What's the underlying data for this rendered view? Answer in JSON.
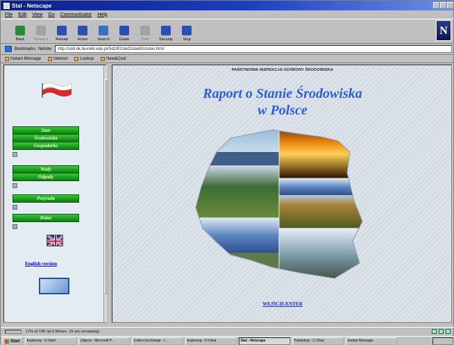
{
  "window": {
    "title": "Stal - Netscape"
  },
  "menu": [
    "File",
    "Edit",
    "View",
    "Go",
    "Communicator",
    "Help"
  ],
  "toolbar": [
    {
      "label": "Back",
      "icon": "back-icon",
      "color": "#2a8a3a"
    },
    {
      "label": "Forward",
      "icon": "forward-icon",
      "color": "#9aa79a",
      "disabled": true
    },
    {
      "label": "Reload",
      "icon": "reload-icon",
      "color": "#2a4fb8"
    },
    {
      "label": "Home",
      "icon": "home-icon",
      "color": "#2a4fb8"
    },
    {
      "label": "Search",
      "icon": "search-icon",
      "color": "#3a6fc8"
    },
    {
      "label": "Guide",
      "icon": "guide-icon",
      "color": "#2a4fb8"
    },
    {
      "label": "Print",
      "icon": "print-icon",
      "color": "#9aa79a",
      "disabled": true
    },
    {
      "label": "Security",
      "icon": "security-icon",
      "color": "#2a4fb8"
    },
    {
      "label": "Stop",
      "icon": "stop-icon",
      "color": "#2a4fb8"
    }
  ],
  "location": {
    "bookmarks_label": "Bookmarks",
    "netsite_label": "Netsite:",
    "url": "http://sdd.ok.biurolik.edu.pl/Sd2/ECdeOzda4/Dzsdos.html"
  },
  "personal_toolbar": [
    "Instant Message",
    "Internet",
    "Lookup",
    "New&Cool"
  ],
  "left_nav": {
    "buttons": [
      {
        "label": "Stan",
        "name": "nav-stan-button"
      },
      {
        "label": "Środowiska",
        "name": "nav-srodowiska-button"
      },
      {
        "label": "Gospodarka",
        "name": "nav-gospodarka-button"
      },
      {
        "label": "Wody",
        "name": "nav-wody-button"
      },
      {
        "label": "Odpady",
        "name": "nav-odpady-button"
      },
      {
        "label": "Przyroda",
        "name": "nav-przyroda-button"
      },
      {
        "label": "Hałas",
        "name": "nav-halas-button"
      }
    ],
    "english_link": "English version"
  },
  "main": {
    "inspectorate": "PAŃSTWOWA INSPEKCJA OCHRONY ŚRODOWISKA",
    "title_line1": "Raport o Stanie Środowiska",
    "title_line2": "w Polsce",
    "enter_link": "WEJŚCIE/ENTER"
  },
  "status": {
    "text": "17% of 73K (at 2.5K/sec, 15 sec remaining)"
  },
  "taskbar": {
    "start_label": "Start",
    "items": [
      {
        "label": "Exploring - K:\\Stal\\",
        "active": false
      },
      {
        "label": "Zdjęcia - Microsoft P...",
        "active": false
      },
      {
        "label": "Collect Exchange - I...",
        "active": false
      },
      {
        "label": "Exploring - D:\\Ulva",
        "active": false
      },
      {
        "label": "Stal - Netscape",
        "active": true
      },
      {
        "label": "Paintshop - C:\\Ulva",
        "active": false
      },
      {
        "label": "Instant Message",
        "active": false
      }
    ]
  }
}
